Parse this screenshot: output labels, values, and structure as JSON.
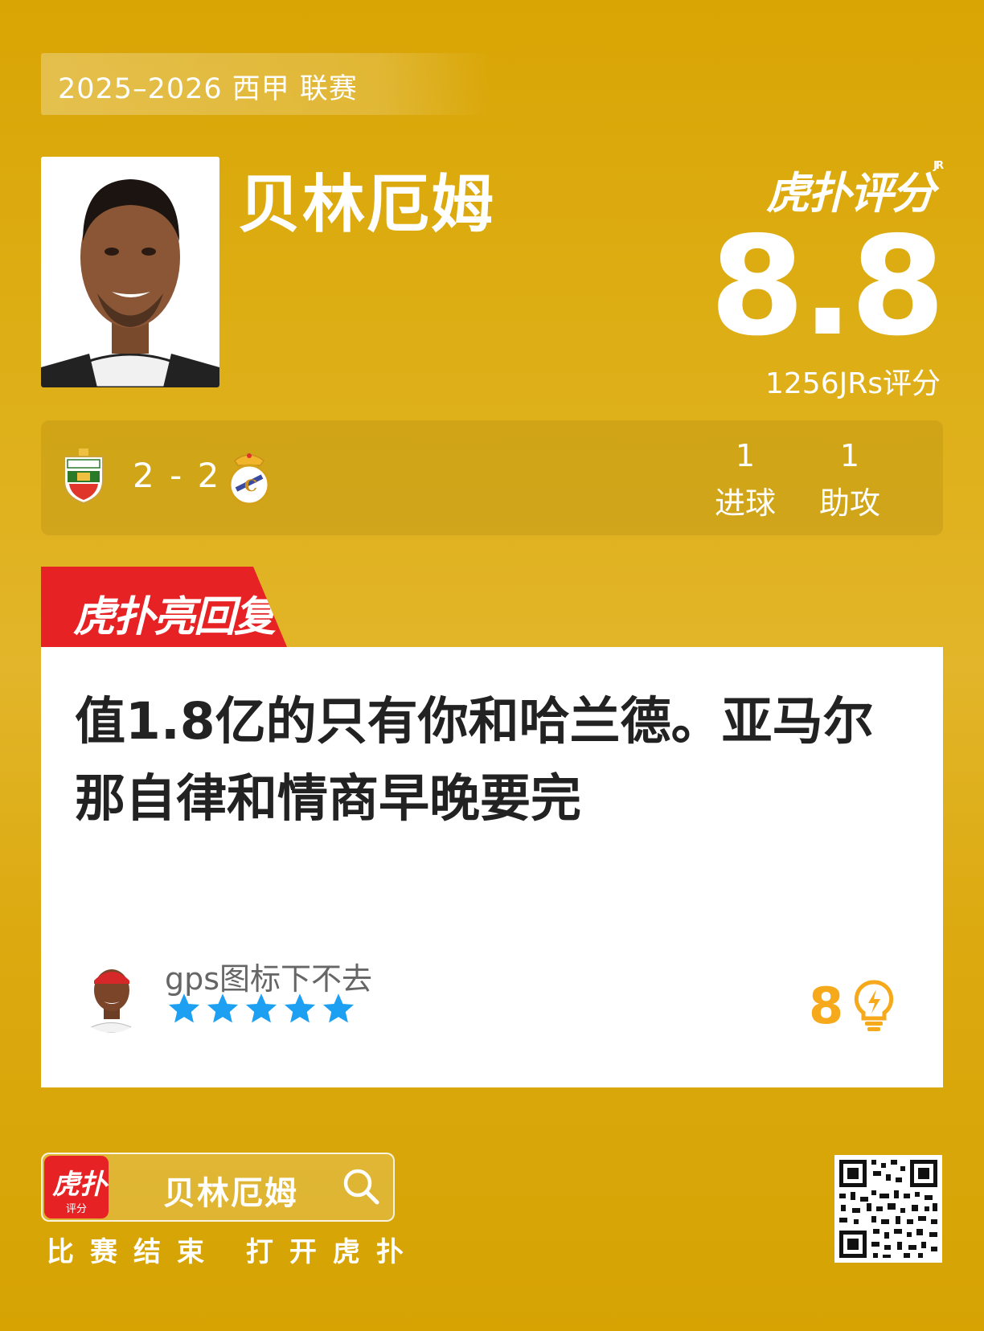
{
  "header": {
    "season_label": "2025–2026 西甲 联赛",
    "player_name": "贝林厄姆",
    "brand_label": "虎扑评分",
    "brand_superscript": "JR",
    "rating": "8.8",
    "rating_count": "1256JRs评分"
  },
  "match": {
    "score": "2 - 2",
    "home_crest": "elche-crest",
    "away_crest": "real-madrid-crest",
    "stats": [
      {
        "value": "1",
        "label": "进球"
      },
      {
        "value": "1",
        "label": "助攻"
      }
    ]
  },
  "highlight": {
    "tag_label": "虎扑亮回复",
    "comment": "值1.8亿的只有你和哈兰德。亚马尔那自律和情商早晚要完",
    "user_name": "gps图标下不去",
    "stars": 5,
    "likes": "8"
  },
  "footer": {
    "app_icon_label": "虎扑",
    "app_icon_sub": "评分",
    "search_text": "贝林厄姆",
    "cta_text": "比赛结束 打开虎扑"
  },
  "colors": {
    "background": "#dcaa10",
    "accent_red": "#e62224",
    "star_blue": "#1ea0f2",
    "like_orange": "#f5a91b"
  }
}
